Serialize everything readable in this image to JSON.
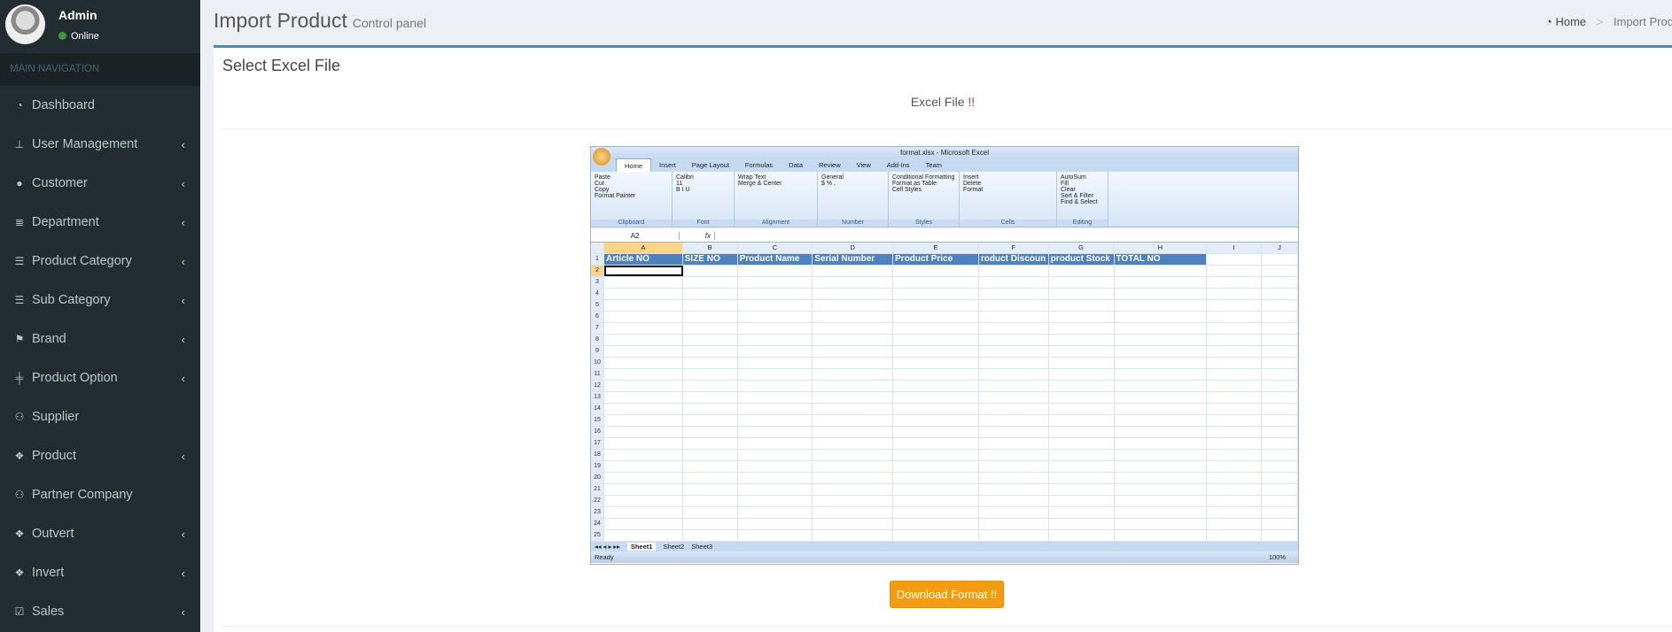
{
  "user": {
    "name": "Admin",
    "status": "Online"
  },
  "sidebar": {
    "header": "MAIN NAVIGATION",
    "items": [
      {
        "label": "Dashboard",
        "icon": "dashboard-icon",
        "glyph": "◔",
        "chevron": false
      },
      {
        "label": "User Management",
        "icon": "sitemap-icon",
        "glyph": "⊥",
        "chevron": true
      },
      {
        "label": "Customer",
        "icon": "user-icon",
        "glyph": "●",
        "chevron": true
      },
      {
        "label": "Department",
        "icon": "database-icon",
        "glyph": "≣",
        "chevron": true
      },
      {
        "label": "Product Category",
        "icon": "list-icon",
        "glyph": "☰",
        "chevron": true
      },
      {
        "label": "Sub Category",
        "icon": "list-icon",
        "glyph": "☰",
        "chevron": true
      },
      {
        "label": "Brand",
        "icon": "flag-icon",
        "glyph": "⚑",
        "chevron": true
      },
      {
        "label": "Product Option",
        "icon": "sliders-icon",
        "glyph": "╪",
        "chevron": true
      },
      {
        "label": "Supplier",
        "icon": "users-icon",
        "glyph": "⚇",
        "chevron": false
      },
      {
        "label": "Product",
        "icon": "cubes-icon",
        "glyph": "❖",
        "chevron": true
      },
      {
        "label": "Partner Company",
        "icon": "users-icon",
        "glyph": "⚇",
        "chevron": false
      },
      {
        "label": "Outvert",
        "icon": "cubes-icon",
        "glyph": "❖",
        "chevron": true
      },
      {
        "label": "Invert",
        "icon": "cubes-icon",
        "glyph": "❖",
        "chevron": true
      },
      {
        "label": "Sales",
        "icon": "calendar-check-icon",
        "glyph": "☑",
        "chevron": true
      }
    ],
    "chevron_glyph": "‹"
  },
  "header": {
    "title": "Import Product",
    "subtitle": "Control panel"
  },
  "breadcrumb": {
    "home": "Home",
    "separator": ">",
    "current": "Import Product"
  },
  "box": {
    "title": "Select Excel File",
    "label": "Excel File",
    "label_suffix": "!!",
    "button": "Download Format !!"
  },
  "colors": {
    "accent": "#3c8dbc",
    "button": "#f39c12",
    "sidebar": "#222d32"
  },
  "excel": {
    "window_title": "format.xlsx - Microsoft Excel",
    "tabs": [
      "Home",
      "Insert",
      "Page Layout",
      "Formulas",
      "Data",
      "Review",
      "View",
      "Add-Ins",
      "Team"
    ],
    "groups": [
      {
        "label": "Clipboard",
        "items": [
          "Paste",
          "Cut",
          "Copy",
          "Format Painter"
        ]
      },
      {
        "label": "Font",
        "items": [
          "Calibri",
          "11",
          "B I U"
        ]
      },
      {
        "label": "Alignment",
        "items": [
          "Wrap Text",
          "Merge & Center"
        ]
      },
      {
        "label": "Number",
        "items": [
          "General",
          "$ % ,"
        ]
      },
      {
        "label": "Styles",
        "items": [
          "Conditional Formatting",
          "Format as Table",
          "Cell Styles"
        ]
      },
      {
        "label": "Cells",
        "items": [
          "Insert",
          "Delete",
          "Format"
        ]
      },
      {
        "label": "Editing",
        "items": [
          "AutoSum",
          "Fill",
          "Clear",
          "Sort & Filter",
          "Find & Select"
        ]
      }
    ],
    "name_box": "A2",
    "fx": "fx",
    "columns": [
      "A",
      "B",
      "C",
      "D",
      "E",
      "F",
      "G",
      "H",
      "I",
      "J"
    ],
    "headers": [
      "Article NO",
      "SIZE NO",
      "Product Name",
      "Serial Number",
      "Product Price",
      "roduct Discoun",
      "product Stock",
      "TOTAL NO"
    ],
    "rows": 25,
    "sheets": [
      "Sheet1",
      "Sheet2",
      "Sheet3"
    ],
    "status": "Ready",
    "zoom": "100%"
  }
}
